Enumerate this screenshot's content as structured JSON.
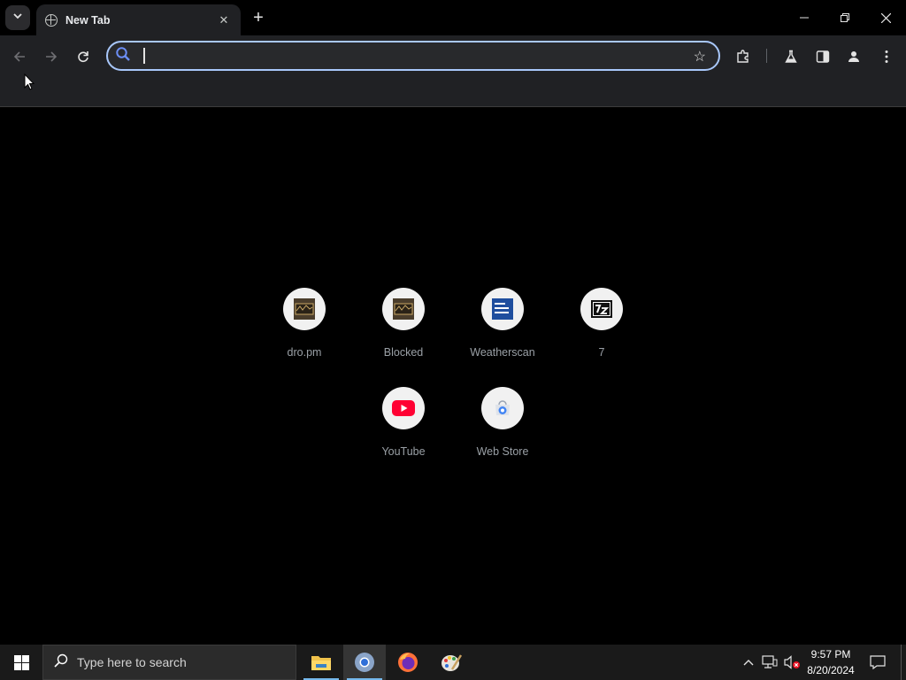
{
  "browser": {
    "tab": {
      "title": "New Tab"
    },
    "omnibox": {
      "value": "",
      "placeholder": ""
    },
    "accent_color": "#a8c7fa"
  },
  "shortcuts": [
    {
      "label": "dro.pm",
      "icon": "dro-pm-favicon"
    },
    {
      "label": "Blocked",
      "icon": "blocked-favicon"
    },
    {
      "label": "Weatherscan",
      "icon": "weather-channel-favicon"
    },
    {
      "label": "7",
      "icon": "7zip-favicon"
    },
    {
      "label": "YouTube",
      "icon": "youtube-favicon"
    },
    {
      "label": "Web Store",
      "icon": "web-store-favicon"
    }
  ],
  "taskbar": {
    "search_placeholder": "Type here to search",
    "apps": [
      {
        "name": "File Explorer",
        "icon": "file-explorer-icon"
      },
      {
        "name": "Chrome",
        "icon": "chrome-icon"
      },
      {
        "name": "Firefox",
        "icon": "firefox-icon"
      },
      {
        "name": "Paint",
        "icon": "paint-icon"
      }
    ],
    "clock": {
      "time": "9:57 PM",
      "date": "8/20/2024"
    }
  }
}
